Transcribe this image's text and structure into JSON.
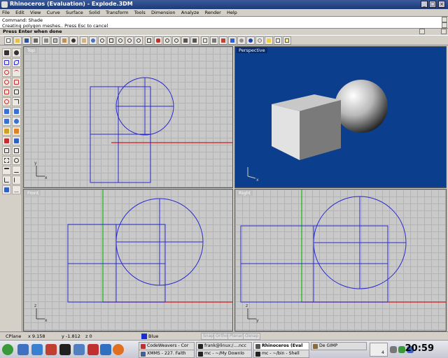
{
  "window": {
    "title": "Rhinoceros (Evaluation) - Explode.3DM",
    "min_glyph": "_",
    "max_glyph": "□",
    "close_glyph": "×"
  },
  "menu": [
    "File",
    "Edit",
    "View",
    "Curve",
    "Surface",
    "Solid",
    "Transform",
    "Tools",
    "Dimension",
    "Analyze",
    "Render",
    "Help"
  ],
  "command": {
    "history_1": "Command: Shade",
    "history_2": "Creating polygon meshes.. Press Esc to cancel",
    "prompt": "Press Enter when done"
  },
  "viewports": {
    "top": "Top",
    "perspective": "Perspective",
    "front": "Front",
    "right": "Right"
  },
  "axis_labels": {
    "x": "x",
    "y": "y",
    "z": "z"
  },
  "status": {
    "cplane": "CPlane",
    "x": "x 9.158",
    "y": "y -1.812",
    "z": "z 0",
    "layer": "Blue",
    "layer_color": "#1a2fd0",
    "toggles": [
      "Snap",
      "Ortho",
      "Planar",
      "Osnap"
    ]
  },
  "taskbar": {
    "tasks_row1": [
      "CodeWeavers - Cor",
      "frank@linux:/....ncc",
      "Rhinoceros (Eval",
      "De GIMP"
    ],
    "tasks_row2": [
      "XMMS - 227. Faith",
      "mc - ~/My Downlo",
      "mc - ~/bin - Shell"
    ],
    "desktop_num": "4",
    "clock": "20:59"
  },
  "colors": {
    "curve": "#2a2ad0",
    "x_axis": "#d01a1a",
    "y_axis": "#18b818",
    "perspective_bg": "#0c3e8e"
  }
}
